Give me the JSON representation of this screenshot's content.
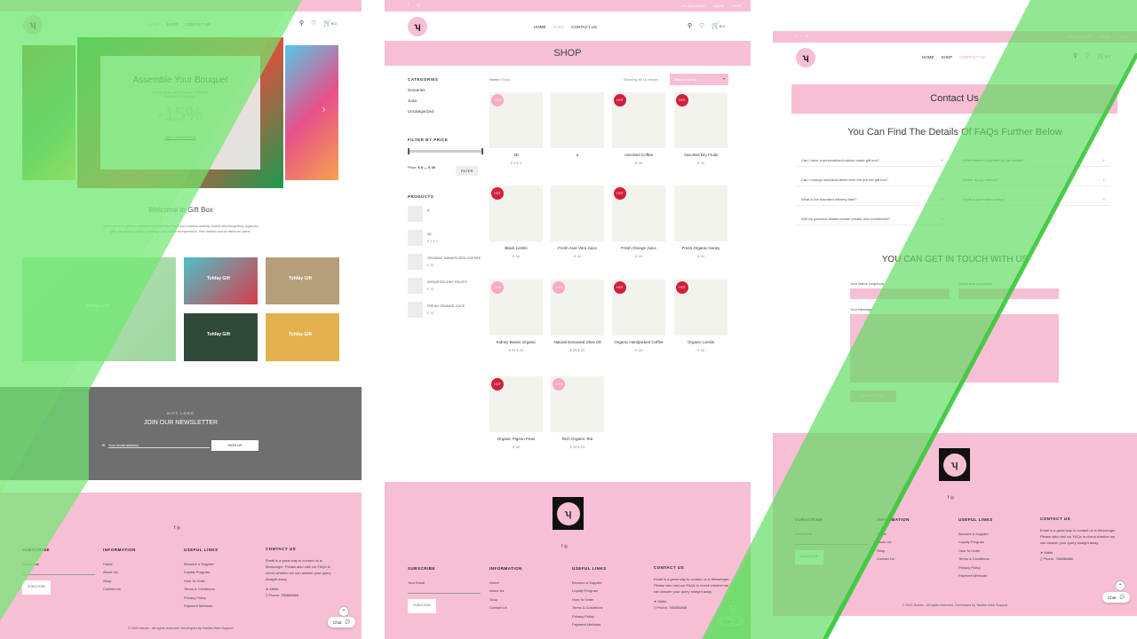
{
  "home": {
    "topbar_links": [],
    "nav": {
      "links": [
        "HOME",
        "SHOP",
        "CONTACT US"
      ],
      "cart_count": "€ 0"
    },
    "hero": {
      "title": "Assemble Your Bouquet",
      "subtitle_line1": "Create your own bouquet of flowers",
      "subtitle_line2": "from our collection.",
      "discount": "-15%",
      "cta": "SEE COLLECTION"
    },
    "welcome": {
      "title": "Welcome to Gift Box",
      "text_line1": "Welcome to our gift box collection by Boxed Fast! Each box contains carefully chosen and thoughtfully organized",
      "text_line2": "gifts, intended to convey a message or to create an experience. Free delivery and no minimum orders."
    },
    "tiles": [
      "Tohfay Gift",
      "Tohfay Gift",
      "Tohfay Gift",
      "Tohfay Gift",
      "Tohfay Gift"
    ],
    "newsletter": {
      "eyebrow": "GIFT LOGO",
      "title": "JOIN OUR NEWSLETTER",
      "placeholder": "Your email address",
      "button": "SIGN UP"
    },
    "footer": {
      "subscribe": {
        "title": "SUBSCRIBE",
        "label": "Your Email",
        "button": "SUBSCRIBE"
      },
      "information": {
        "title": "INFORMATION",
        "items": [
          "Home",
          "About Us",
          "Shop",
          "Contact Us"
        ]
      },
      "useful": {
        "title": "USEFUL LINKS",
        "items": [
          "Become a Supplier",
          "Loyalty Program",
          "How To Order",
          "Terms & Conditions",
          "Privacy Policy",
          "Payment Methods"
        ]
      },
      "contact": {
        "title": "CONTACT US",
        "text": "Email is a great way to contact us is Messenger. Please also visit our FAQs to check whether we can answer your query straight away.",
        "location": "Malta",
        "phone": "Phone: 786556866"
      },
      "copyright": "© 2021 Boxes . All rights reserved. Developed by Tashke Web Support",
      "chat": "Chat"
    }
  },
  "shop": {
    "topbar_links": [
      "MY ACCOUNT",
      "HOME",
      "CART"
    ],
    "nav": {
      "links": [
        "HOME",
        "SHOP",
        "CONTACT US"
      ],
      "cart_count": "€ 0"
    },
    "banner": "SHOP",
    "breadcrumb": [
      "Home",
      "Shop"
    ],
    "showing": "Showing all 14 results",
    "sort": "Default sorting",
    "categories": {
      "title": "CATEGORIES",
      "items": [
        "Groceries",
        "Juice",
        "Uncategorized"
      ]
    },
    "filter": {
      "title": "FILTER BY PRICE",
      "price_label": "Price:",
      "price_range": "€ 0 — € 40",
      "button": "FILTER"
    },
    "products_side": {
      "title": "PRODUCTS",
      "items": [
        {
          "name": "A",
          "price": ""
        },
        {
          "name": "3D",
          "price": "€ 5  € 4"
        },
        {
          "name": "ORGANIC HANDPICKED COFFEE",
          "price": "€ 38"
        },
        {
          "name": "ASSORTED DRY FRUITS",
          "price": "€ 16"
        },
        {
          "name": "FRESH ORANGE JUICE",
          "price": "€ 18"
        }
      ]
    },
    "products": [
      {
        "name": "3D",
        "price": "€ 5  € 4",
        "badge": "-20%",
        "sale": true
      },
      {
        "name": "a",
        "price": "",
        "badge": "",
        "sale": false
      },
      {
        "name": "Assorted Coffee",
        "price": "€ 38",
        "badge": "HOT",
        "sale": false
      },
      {
        "name": "Assorted Dry Fruits",
        "price": "€ 16",
        "badge": "HOT",
        "sale": false
      },
      {
        "name": "Black Lentils",
        "price": "€ 34",
        "badge": "HOT",
        "sale": false
      },
      {
        "name": "Fresh Aloe Vera Juice",
        "price": "€ 34",
        "badge": "",
        "sale": false
      },
      {
        "name": "Fresh Orange Juice",
        "price": "€ 18",
        "badge": "HOT",
        "sale": false
      },
      {
        "name": "Fresh Organic Honey",
        "price": "€ 34",
        "badge": "",
        "sale": false
      },
      {
        "name": "Kidney Beans Organic",
        "price": "€ 26  € 20",
        "badge": "-23%",
        "sale": true
      },
      {
        "name": "Natural Extracted Olive Oil",
        "price": "€ 28  € 25",
        "badge": "-10%",
        "sale": true
      },
      {
        "name": "Organic Handpicked Coffee",
        "price": "€ 18",
        "badge": "HOT",
        "sale": false
      },
      {
        "name": "Organic Lentils",
        "price": "€ 16",
        "badge": "HOT",
        "sale": false
      },
      {
        "name": "Organic Pigeon Peas",
        "price": "€ 36",
        "badge": "HOT",
        "sale": false
      },
      {
        "name": "Rich Organic Tea",
        "price": "€ 28  € 25",
        "badge": "-10%",
        "sale": true
      }
    ],
    "footer": {
      "subscribe": {
        "title": "SUBSCRIBE",
        "label": "Your Email",
        "button": "SUBSCRIBE"
      },
      "information": {
        "title": "INFORMATION",
        "items": [
          "Home",
          "About Us",
          "Shop",
          "Contact Us"
        ]
      },
      "useful": {
        "title": "USEFUL LINKS",
        "items": [
          "Become a Supplier",
          "Loyalty Program",
          "How To Order",
          "Terms & Conditions",
          "Privacy Policy",
          "Payment Methods"
        ]
      },
      "contact": {
        "title": "CONTACT US",
        "text": "Email is a great way to contact us is Messenger. Please also visit our FAQs to check whether we can answer your query straight away.",
        "location": "Malta",
        "phone": "Phone: 786556866"
      },
      "chat": "Chat"
    }
  },
  "contact": {
    "topbar_links": [
      "MY ACCOUNT",
      "HOME",
      "CART"
    ],
    "nav": {
      "links": [
        "HOME",
        "SHOP",
        "CONTACT US"
      ],
      "cart_count": "€ 0"
    },
    "banner": "Contact Us",
    "faq_title": "You Can Find The Details Of FAQs Further Below",
    "faqs_left": [
      "Can I have a personalised/custom made gift box?",
      "Can I change individual items from the pre-set gift box?",
      "What is the standard delivery time?",
      "Will my personal details remain private and confidential?"
    ],
    "faqs_right": [
      "What forms of payment do you accept?",
      "Where do you deliver?",
      "What is your return policy?"
    ],
    "form": {
      "title": "YOU CAN GET IN TOUCH WITH US",
      "name_label": "Your Name (required)",
      "email_label": "Your Email (required)",
      "message_label": "Your Message",
      "button": "SEND MESSAGE"
    },
    "footer": {
      "subscribe": {
        "title": "SUBSCRIBE",
        "label": "Your Email",
        "button": "SUBSCRIBE"
      },
      "information": {
        "title": "INFORMATION",
        "items": [
          "Home",
          "About Us",
          "Shop",
          "Contact Us"
        ]
      },
      "useful": {
        "title": "USEFUL LINKS",
        "items": [
          "Become a Supplier",
          "Loyalty Program",
          "How To Order",
          "Terms & Conditions",
          "Privacy Policy",
          "Payment Methods"
        ]
      },
      "contact": {
        "title": "CONTACT US",
        "text": "Email is a great way to contact us is Messenger. Please also visit our FAQs to check whether we can answer your query straight away.",
        "location": "Malta",
        "phone": "Phone: 786556866"
      },
      "copyright": "© 2021 Boxes . All rights reserved. Developed by Tashke Web Support",
      "chat": "Chat"
    }
  },
  "colors": {
    "brand_pink": "#f7bfd6",
    "overlay_green": "#6ee86e",
    "hot_badge": "#d2203c"
  }
}
